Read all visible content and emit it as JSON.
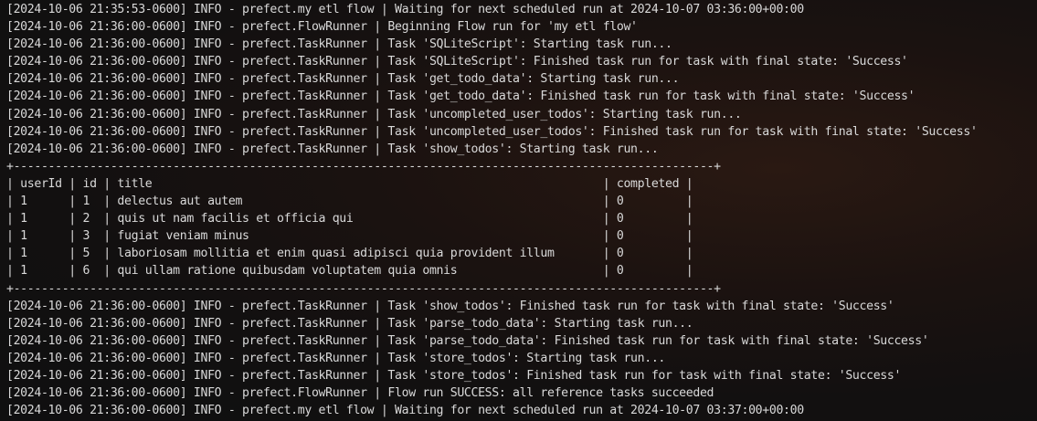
{
  "terminal": {
    "lines": [
      "[2024-10-06 21:35:53-0600] INFO - prefect.my etl flow | Waiting for next scheduled run at 2024-10-07 03:36:00+00:00",
      "[2024-10-06 21:36:00-0600] INFO - prefect.FlowRunner | Beginning Flow run for 'my etl flow'",
      "[2024-10-06 21:36:00-0600] INFO - prefect.TaskRunner | Task 'SQLiteScript': Starting task run...",
      "[2024-10-06 21:36:00-0600] INFO - prefect.TaskRunner | Task 'SQLiteScript': Finished task run for task with final state: 'Success'",
      "[2024-10-06 21:36:00-0600] INFO - prefect.TaskRunner | Task 'get_todo_data': Starting task run...",
      "[2024-10-06 21:36:00-0600] INFO - prefect.TaskRunner | Task 'get_todo_data': Finished task run for task with final state: 'Success'",
      "[2024-10-06 21:36:00-0600] INFO - prefect.TaskRunner | Task 'uncompleted_user_todos': Starting task run...",
      "[2024-10-06 21:36:00-0600] INFO - prefect.TaskRunner | Task 'uncompleted_user_todos': Finished task run for task with final state: 'Success'",
      "[2024-10-06 21:36:00-0600] INFO - prefect.TaskRunner | Task 'show_todos': Starting task run...",
      "+-----------------------------------------------------------------------------------------------------+",
      "| userId | id | title                                                                 | completed |",
      "| 1      | 1  | delectus aut autem                                                    | 0         |",
      "| 1      | 2  | quis ut nam facilis et officia qui                                    | 0         |",
      "| 1      | 3  | fugiat veniam minus                                                   | 0         |",
      "| 1      | 5  | laboriosam mollitia et enim quasi adipisci quia provident illum       | 0         |",
      "| 1      | 6  | qui ullam ratione quibusdam voluptatem quia omnis                     | 0         |",
      "+-----------------------------------------------------------------------------------------------------+",
      "[2024-10-06 21:36:00-0600] INFO - prefect.TaskRunner | Task 'show_todos': Finished task run for task with final state: 'Success'",
      "[2024-10-06 21:36:00-0600] INFO - prefect.TaskRunner | Task 'parse_todo_data': Starting task run...",
      "[2024-10-06 21:36:00-0600] INFO - prefect.TaskRunner | Task 'parse_todo_data': Finished task run for task with final state: 'Success'",
      "[2024-10-06 21:36:00-0600] INFO - prefect.TaskRunner | Task 'store_todos': Starting task run...",
      "[2024-10-06 21:36:00-0600] INFO - prefect.TaskRunner | Task 'store_todos': Finished task run for task with final state: 'Success'",
      "[2024-10-06 21:36:00-0600] INFO - prefect.FlowRunner | Flow run SUCCESS: all reference tasks succeeded",
      "[2024-10-06 21:36:00-0600] INFO - prefect.my etl flow | Waiting for next scheduled run at 2024-10-07 03:37:00+00:00"
    ]
  }
}
